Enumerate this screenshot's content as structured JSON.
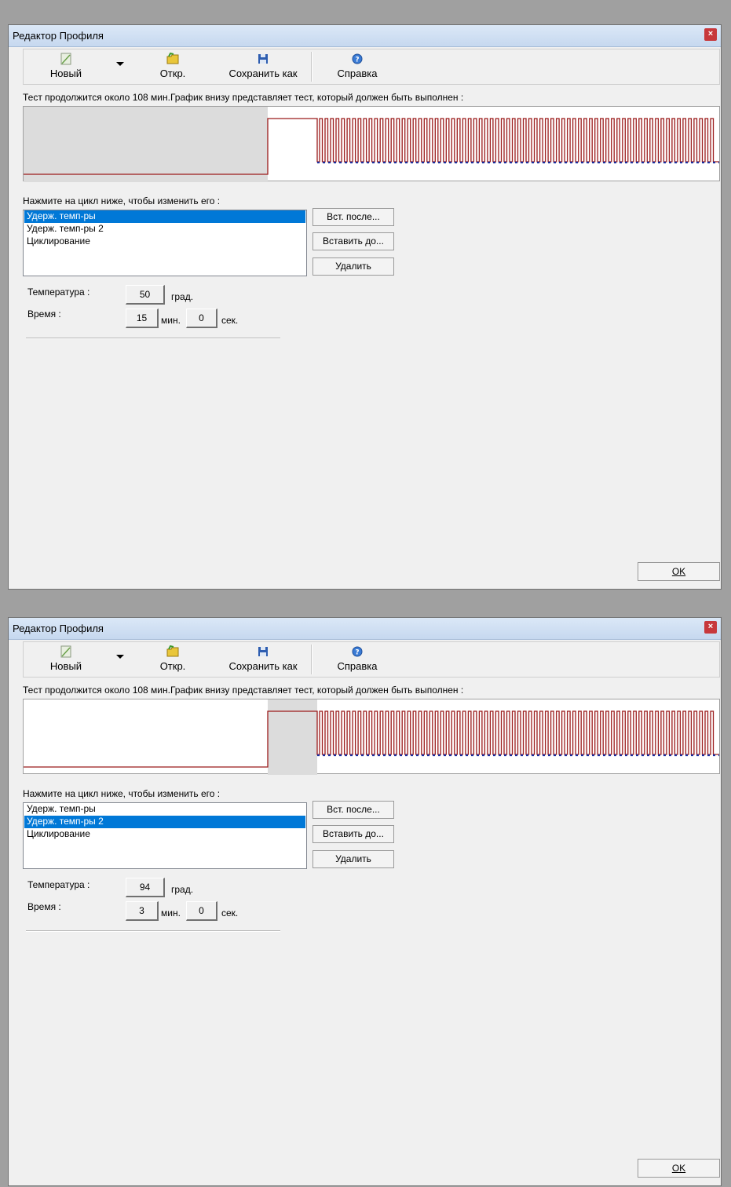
{
  "windows": [
    {
      "title": "Редактор Профиля",
      "close": "×",
      "toolbar": {
        "new": "Новый",
        "open": "Откр.",
        "saveas": "Сохранить как",
        "help": "Справка"
      },
      "info": "Тест продолжится около 108 мин.График внизу представляет тест, который должен быть выполнен :",
      "highlighted_step": 1,
      "prompt": "Нажмите на цикл ниже, чтобы изменить его :",
      "steps": [
        "Удерж. темп-ры",
        "Удерж. темп-ры 2",
        "Циклирование"
      ],
      "selected_index": 0,
      "buttons": {
        "insert_after": "Вст. после...",
        "insert_before": "Вставить до...",
        "delete": "Удалить"
      },
      "temp_label": "Температура :",
      "temp_value": "50",
      "temp_unit": "град.",
      "time_label": "Время :",
      "time_min": "15",
      "min_unit": "мин.",
      "time_sec": "0",
      "sec_unit": "сек.",
      "ok": "OK"
    },
    {
      "title": "Редактор Профиля",
      "close": "×",
      "toolbar": {
        "new": "Новый",
        "open": "Откр.",
        "saveas": "Сохранить как",
        "help": "Справка"
      },
      "info": "Тест продолжится около 108 мин.График внизу представляет тест, который должен быть выполнен :",
      "highlighted_step": 2,
      "prompt": "Нажмите на цикл ниже, чтобы изменить его :",
      "steps": [
        "Удерж. темп-ры",
        "Удерж. темп-ры 2",
        "Циклирование"
      ],
      "selected_index": 1,
      "buttons": {
        "insert_after": "Вст. после...",
        "insert_before": "Вставить до...",
        "delete": "Удалить"
      },
      "temp_label": "Температура :",
      "temp_value": "94",
      "temp_unit": "град.",
      "time_label": "Время :",
      "time_min": "3",
      "min_unit": "мин.",
      "time_sec": "0",
      "sec_unit": "сек.",
      "ok": "OK"
    }
  ],
  "colors": {
    "profile_line": "#9b1b1b",
    "baseline_dash": "#1a2fa0",
    "highlight": "#dcdcdc",
    "selection": "#0078d7"
  }
}
